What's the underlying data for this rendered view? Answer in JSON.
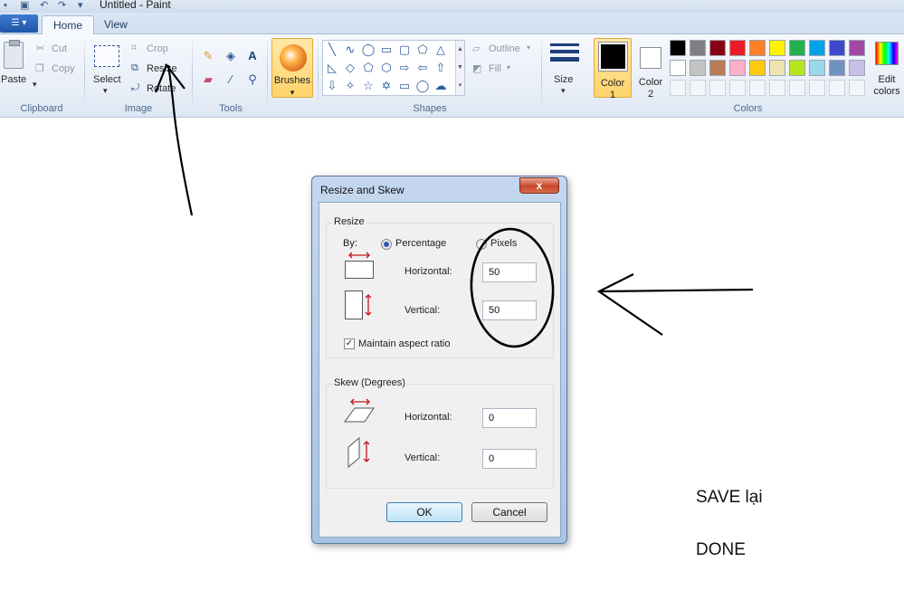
{
  "window": {
    "title": "Untitled - Paint"
  },
  "tabs": [
    {
      "label": "Home"
    },
    {
      "label": "View"
    }
  ],
  "ribbon": {
    "clipboard": {
      "paste_label": "Paste",
      "cut_label": "Cut",
      "copy_label": "Copy",
      "group_label": "Clipboard"
    },
    "image": {
      "select_label": "Select",
      "crop_label": "Crop",
      "resize_label": "Resize",
      "rotate_label": "Rotate",
      "group_label": "Image"
    },
    "tools": {
      "group_label": "Tools",
      "items": [
        "pencil-icon",
        "fill-icon",
        "text-icon",
        "eraser-icon",
        "color-picker-icon",
        "magnifier-icon"
      ]
    },
    "brushes": {
      "label": "Brushes"
    },
    "shapes": {
      "group_label": "Shapes",
      "outline_label": "Outline",
      "fill_label": "Fill",
      "items": [
        "line",
        "curve",
        "oval",
        "rectangle",
        "rounded-rectangle",
        "polygon",
        "triangle",
        "right-triangle",
        "diamond",
        "pentagon",
        "hexagon",
        "right-arrow",
        "left-arrow",
        "up-arrow",
        "down-arrow",
        "four-point-star",
        "five-point-star",
        "six-point-star",
        "rounded-callout",
        "oval-callout",
        "cloud-callout"
      ]
    },
    "size": {
      "label": "Size"
    },
    "colors": {
      "group_label": "Colors",
      "color1_label_line1": "Color",
      "color1_label_line2": "1",
      "color2_label_line1": "Color",
      "color2_label_line2": "2",
      "edit_label_line1": "Edit",
      "edit_label_line2": "colors",
      "color1": "#000000",
      "color2": "#ffffff",
      "palette_row1": [
        "#000000",
        "#7f7f7f",
        "#880015",
        "#ed1c24",
        "#ff7f27",
        "#fff200",
        "#22b14c",
        "#00a2e8",
        "#3f48cc",
        "#a349a4"
      ],
      "palette_row2": [
        "#ffffff",
        "#c3c3c3",
        "#b97a57",
        "#ffaec9",
        "#ffc90e",
        "#efe4b0",
        "#b5e61d",
        "#99d9ea",
        "#7092be",
        "#c8bfe7"
      ]
    }
  },
  "dialog": {
    "title": "Resize and Skew",
    "close_symbol": "x",
    "resize": {
      "legend": "Resize",
      "by_label": "By:",
      "percentage_label": "Percentage",
      "pixels_label": "Pixels",
      "selected": "Percentage",
      "horizontal_label": "Horizontal:",
      "horizontal_value": "50",
      "vertical_label": "Vertical:",
      "vertical_value": "50",
      "maintain_label": "Maintain aspect ratio",
      "maintain_checked": true
    },
    "skew": {
      "legend": "Skew (Degrees)",
      "horizontal_label": "Horizontal:",
      "horizontal_value": "0",
      "vertical_label": "Vertical:",
      "vertical_value": "0"
    },
    "ok_label": "OK",
    "cancel_label": "Cancel"
  },
  "annotations": {
    "note1": "SAVE lại",
    "note2": "DONE"
  }
}
